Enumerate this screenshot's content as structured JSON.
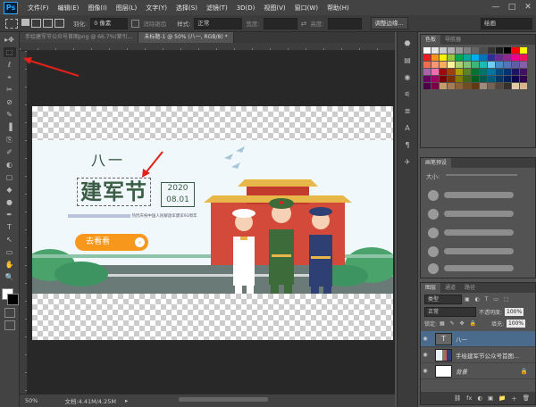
{
  "app": {
    "logo": "Ps"
  },
  "menu": [
    "文件(F)",
    "编辑(E)",
    "图像(I)",
    "图层(L)",
    "文字(Y)",
    "选择(S)",
    "滤镜(T)",
    "3D(D)",
    "视图(V)",
    "窗口(W)",
    "帮助(H)"
  ],
  "window_controls": [
    "—",
    "□",
    "✕"
  ],
  "options": {
    "feather_label": "羽化:",
    "feather_value": "0 像素",
    "antialias_label": "消除锯齿",
    "style_label": "样式:",
    "style_value": "正常",
    "width_label": "宽度:",
    "height_label": "高度:",
    "refine_button": "调整边缘...",
    "workspace": "绘画"
  },
  "tabs": [
    {
      "label": "手绘建军节公众号首图png @ 66.7%(紫引...",
      "active": false
    },
    {
      "label": "未标题-1 @ 50% (八一, RGB/8) *",
      "active": true
    }
  ],
  "tools": [
    "▸✥",
    "⬚",
    "ℓ",
    "⌖",
    "✂",
    "⊘",
    "✎",
    "▐",
    "⎘",
    "✐",
    "◐",
    "▢",
    "◆",
    "●",
    "✒",
    "T",
    "↖",
    "▭",
    "✋",
    "🔍"
  ],
  "canvas_content": {
    "title_small": "八一",
    "title_big": "建军节",
    "date_year": "2020",
    "date_day": "08.01",
    "subtitle": "热烈庆祝中国人民解放军建军93周年",
    "cta": "去看看",
    "cta_arrow": "›"
  },
  "status": {
    "zoom": "50%",
    "doc": "文档:4.41M/4.25M",
    "arrow": "▸"
  },
  "panel_strip": [
    "⬣",
    "▤",
    "◉",
    "⚟",
    "≣",
    "A",
    "¶",
    "✈"
  ],
  "swatches_panel": {
    "tabs": [
      "色板",
      "导航器"
    ],
    "colors": [
      "#ffffff",
      "#e6e6e6",
      "#cccccc",
      "#b3b3b3",
      "#999999",
      "#808080",
      "#666666",
      "#4d4d4d",
      "#333333",
      "#1a1a1a",
      "#000000",
      "#ff0000",
      "#ffff00",
      "#ed1c24",
      "#f7941d",
      "#fff200",
      "#8dc63f",
      "#00a651",
      "#00a99d",
      "#00aeef",
      "#0072bc",
      "#2e3192",
      "#662d91",
      "#92278f",
      "#ec008c",
      "#ed145b",
      "#f26c4f",
      "#f69679",
      "#fbaf5d",
      "#fff799",
      "#acd373",
      "#7cc576",
      "#3bb878",
      "#1abbb4",
      "#6dcff6",
      "#448ccb",
      "#5674b9",
      "#605ca8",
      "#855fa8",
      "#a864a8",
      "#f06eaa",
      "#9e0b0f",
      "#a0410d",
      "#aba000",
      "#598527",
      "#007236",
      "#00746b",
      "#0076a3",
      "#004a80",
      "#003471",
      "#1b1464",
      "#440e62",
      "#630460",
      "#9e005d",
      "#790000",
      "#7b2e00",
      "#827b00",
      "#406618",
      "#005e20",
      "#005952",
      "#005b7f",
      "#003663",
      "#002157",
      "#0d004c",
      "#32004b",
      "#4b0049",
      "#7b0046",
      "#c69c6d",
      "#a67c52",
      "#8c6239",
      "#754c24",
      "#603913",
      "#9e8b7a",
      "#736357",
      "#534741",
      "#362f2d",
      "#e3c9a8",
      "#d9b48f"
    ]
  },
  "brush_panel": {
    "tabs": [
      "画笔预设"
    ],
    "size_label": "大小:"
  },
  "layers_panel": {
    "tabs": [
      "图层",
      "通道",
      "路径"
    ],
    "kind_label": "类型",
    "blend_mode": "正常",
    "opacity_label": "不透明度:",
    "opacity_value": "100%",
    "lock_label": "锁定:",
    "fill_label": "填充:",
    "fill_value": "100%",
    "layers": [
      {
        "name": "八一",
        "type": "text",
        "selected": true,
        "thumb": "T"
      },
      {
        "name": "手绘建军节公众号首图...",
        "type": "image",
        "selected": false,
        "thumb": ""
      },
      {
        "name": "背景",
        "type": "background",
        "selected": false,
        "thumb": ""
      }
    ],
    "footer_icons": [
      "⛓",
      "fx",
      "◐",
      "▣",
      "📁",
      "＋",
      "🗑"
    ]
  }
}
